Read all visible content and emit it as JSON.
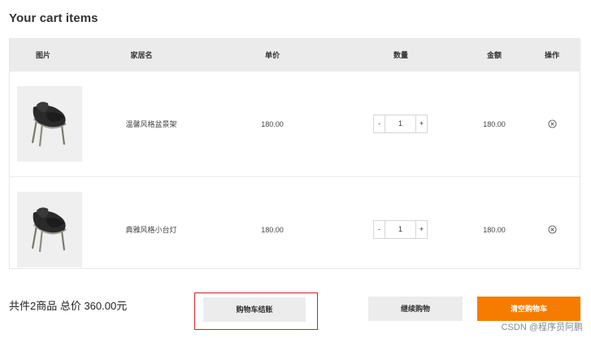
{
  "page": {
    "title": "Your cart items"
  },
  "table": {
    "headers": {
      "image": "图片",
      "name": "家居名",
      "unit_price": "单价",
      "quantity": "数量",
      "amount": "金额",
      "action": "操作"
    },
    "rows": [
      {
        "name": "温馨风格盆景架",
        "unit_price": "180.00",
        "qty_minus": "-",
        "quantity": "1",
        "qty_plus": "+",
        "amount": "180.00",
        "remove_icon": "remove-circle-icon"
      },
      {
        "name": "典雅风格小台灯",
        "unit_price": "180.00",
        "qty_minus": "-",
        "quantity": "1",
        "qty_plus": "+",
        "amount": "180.00",
        "remove_icon": "remove-circle-icon"
      }
    ]
  },
  "footer": {
    "summary": "共件2商品 总价 360.00元",
    "checkout_label": "购物车结账",
    "continue_label": "继续购物",
    "clear_label": "清空购物车"
  },
  "watermark": "CSDN @程序员阿鹏",
  "colors": {
    "accent": "#f57c00",
    "highlight_border": "#c8252c",
    "header_bg": "#ebebeb"
  }
}
